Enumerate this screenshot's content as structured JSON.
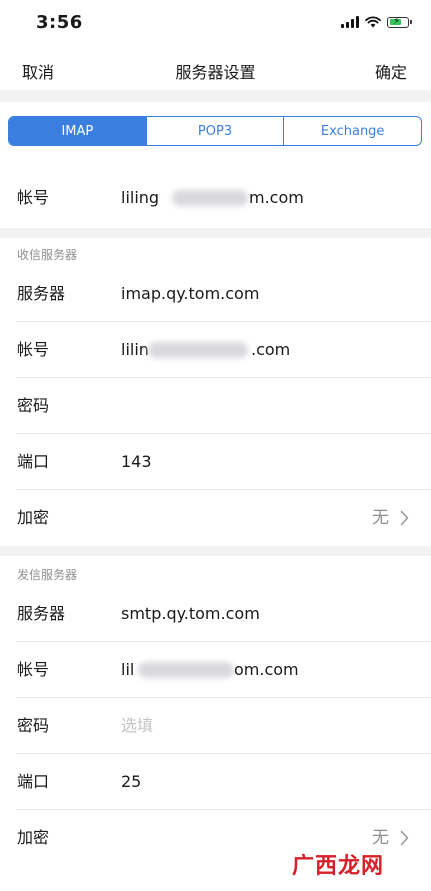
{
  "status_bar": {
    "time": "3:56"
  },
  "nav": {
    "cancel": "取消",
    "title": "服务器设置",
    "confirm": "确定"
  },
  "tabs": [
    {
      "label": "IMAP",
      "active": true
    },
    {
      "label": "POP3",
      "active": false
    },
    {
      "label": "Exchange",
      "active": false
    }
  ],
  "account": {
    "label": "帐号",
    "value_start": "liling",
    "value_end": "m.com"
  },
  "incoming": {
    "header": "收信服务器",
    "server_label": "服务器",
    "server_value": "imap.qy.tom.com",
    "account_label": "帐号",
    "account_value_start": "lilin",
    "account_value_end": ".com",
    "password_label": "密码",
    "port_label": "端口",
    "port_value": "143",
    "encryption_label": "加密",
    "encryption_value": "无"
  },
  "outgoing": {
    "header": "发信服务器",
    "server_label": "服务器",
    "server_value": "smtp.qy.tom.com",
    "account_label": "帐号",
    "account_value_start": "lil",
    "account_value_end": "om.com",
    "password_label": "密码",
    "password_placeholder": "选填",
    "port_label": "端口",
    "port_value": "25",
    "encryption_label": "加密",
    "encryption_value": "无"
  },
  "watermark": "广西龙网",
  "colors": {
    "accent": "#3a7fe0",
    "separator": "#e6e6ea",
    "group_bg": "#f2f2f4",
    "secondary_text": "#8e8e93"
  }
}
